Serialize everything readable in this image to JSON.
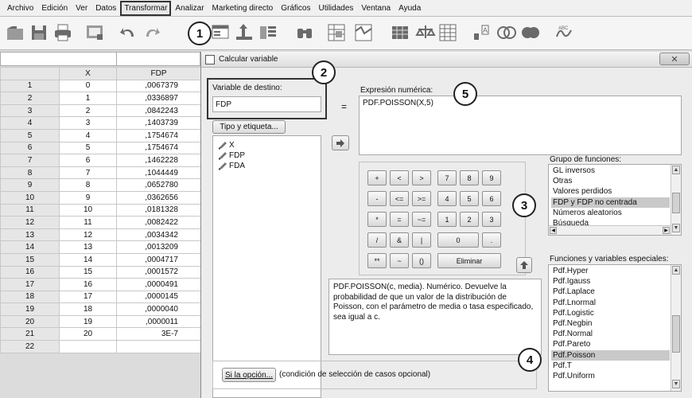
{
  "menu": [
    "Archivo",
    "Edición",
    "Ver",
    "Datos",
    "Transformar",
    "Analizar",
    "Marketing directo",
    "Gráficos",
    "Utilidades",
    "Ventana",
    "Ayuda"
  ],
  "toolbar_icons": [
    "open-folder-icon",
    "save-icon",
    "print-icon",
    "dialog-recall-icon",
    "undo-icon",
    "redo-icon",
    "goto-case-icon",
    "goto-variable-icon",
    "variables-icon",
    "find-icon",
    "insert-cases-icon",
    "insert-variable-icon",
    "split-file-icon",
    "weight-cases-icon",
    "select-cases-icon",
    "value-labels-icon",
    "use-sets-icon",
    "show-sets-icon",
    "spell-check-icon"
  ],
  "grid": {
    "headers": [
      "X",
      "FDP"
    ],
    "rows": [
      {
        "n": "1",
        "x": "0",
        "fdp": ",0067379"
      },
      {
        "n": "2",
        "x": "1",
        "fdp": ",0336897"
      },
      {
        "n": "3",
        "x": "2",
        "fdp": ",0842243"
      },
      {
        "n": "4",
        "x": "3",
        "fdp": ",1403739"
      },
      {
        "n": "5",
        "x": "4",
        "fdp": ",1754674"
      },
      {
        "n": "6",
        "x": "5",
        "fdp": ",1754674"
      },
      {
        "n": "7",
        "x": "6",
        "fdp": ",1462228"
      },
      {
        "n": "8",
        "x": "7",
        "fdp": ",1044449"
      },
      {
        "n": "9",
        "x": "8",
        "fdp": ",0652780"
      },
      {
        "n": "10",
        "x": "9",
        "fdp": ",0362656"
      },
      {
        "n": "11",
        "x": "10",
        "fdp": ",0181328"
      },
      {
        "n": "12",
        "x": "11",
        "fdp": ",0082422"
      },
      {
        "n": "13",
        "x": "12",
        "fdp": ",0034342"
      },
      {
        "n": "14",
        "x": "13",
        "fdp": ",0013209"
      },
      {
        "n": "15",
        "x": "14",
        "fdp": ",0004717"
      },
      {
        "n": "16",
        "x": "15",
        "fdp": ",0001572"
      },
      {
        "n": "17",
        "x": "16",
        "fdp": ",0000491"
      },
      {
        "n": "18",
        "x": "17",
        "fdp": ",0000145"
      },
      {
        "n": "19",
        "x": "18",
        "fdp": ",0000040"
      },
      {
        "n": "20",
        "x": "19",
        "fdp": ",0000011"
      },
      {
        "n": "21",
        "x": "20",
        "fdp": "3E-7"
      },
      {
        "n": "22",
        "x": "",
        "fdp": ""
      }
    ]
  },
  "dialog": {
    "title": "Calcular variable",
    "close_label": "✕",
    "target_label": "Variable de destino:",
    "target_value": "FDP",
    "type_label_button": "Tipo y etiqueta...",
    "equals": "=",
    "expression_label": "Expresión numérica:",
    "expression_value": "PDF.POISSON(X,5)",
    "variables": [
      "X",
      "FDP",
      "FDA"
    ],
    "keypad": [
      [
        "+",
        "<",
        ">",
        "7",
        "8",
        "9"
      ],
      [
        "-",
        "<=",
        ">=",
        "4",
        "5",
        "6"
      ],
      [
        "*",
        "=",
        "~=",
        "1",
        "2",
        "3"
      ],
      [
        "/",
        "&",
        "|",
        "0",
        "."
      ],
      [
        "**",
        "~",
        "()",
        "Eliminar"
      ]
    ],
    "description": "PDF.POISSON(c, media). Numérico. Devuelve la probabilidad de que un valor de la distribución de Poisson, con el parámetro de media o tasa especificado, sea igual a c.",
    "function_group_label": "Grupo de funciones:",
    "function_groups": [
      "GL inversos",
      "Otras",
      "Valores perdidos",
      "FDP y FDP no centrada",
      "Números aleatorios",
      "Búsqueda"
    ],
    "function_group_selected": "FDP y FDP no centrada",
    "special_functions_label": "Funciones y variables especiales:",
    "special_functions": [
      "Pdf.Hyper",
      "Pdf.Igauss",
      "Pdf.Laplace",
      "Pdf.Lnormal",
      "Pdf.Logistic",
      "Pdf.Negbin",
      "Pdf.Normal",
      "Pdf.Pareto",
      "Pdf.Poisson",
      "Pdf.T",
      "Pdf.Uniform"
    ],
    "special_function_selected": "Pdf.Poisson",
    "if_button": "Si la opción...",
    "if_text": "(condición de selección de casos opcional)"
  },
  "callouts": [
    "1",
    "2",
    "3",
    "4",
    "5"
  ]
}
